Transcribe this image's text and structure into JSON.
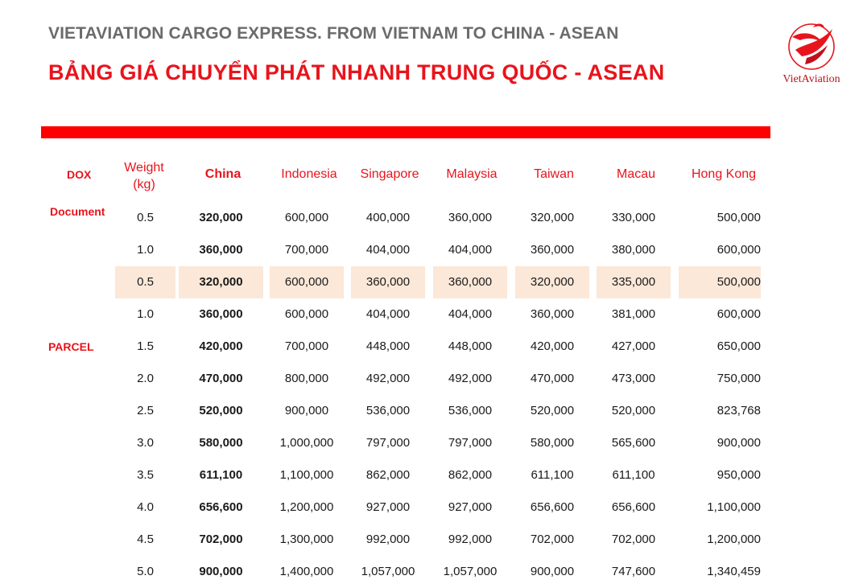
{
  "header": {
    "subtitle": "VIETAVIATION CARGO EXPRESS. FROM VIETNAM TO CHINA - ASEAN",
    "title": "BẢNG GIÁ CHUYỂN PHÁT NHANH TRUNG QUỐC - ASEAN"
  },
  "logo": {
    "text": "VietAviation"
  },
  "colors": {
    "brand_red": "#e8141c",
    "bar_red": "#ff0000",
    "highlight": "#fce8d8",
    "subtitle_gray": "#6b6b6b"
  },
  "table": {
    "headers": {
      "dox": "DOX",
      "weight": "Weight (kg)",
      "china": "China",
      "indonesia": "Indonesia",
      "singapore": "Singapore",
      "malaysia": "Malaysia",
      "taiwan": "Taiwan",
      "macau": "Macau",
      "hongkong": "Hong Kong"
    },
    "section_labels": {
      "document": "Document",
      "parcel": "PARCEL"
    },
    "rows": [
      {
        "weight": "0.5",
        "china": "320,000",
        "indonesia": "600,000",
        "singapore": "400,000",
        "malaysia": "360,000",
        "taiwan": "320,000",
        "macau": "330,000",
        "hongkong": "500,000"
      },
      {
        "weight": "1.0",
        "china": "360,000",
        "indonesia": "700,000",
        "singapore": "404,000",
        "malaysia": "404,000",
        "taiwan": "360,000",
        "macau": "380,000",
        "hongkong": "600,000"
      },
      {
        "weight": "0.5",
        "china": "320,000",
        "indonesia": "600,000",
        "singapore": "360,000",
        "malaysia": "360,000",
        "taiwan": "320,000",
        "macau": "335,000",
        "hongkong": "500,000"
      },
      {
        "weight": "1.0",
        "china": "360,000",
        "indonesia": "600,000",
        "singapore": "404,000",
        "malaysia": "404,000",
        "taiwan": "360,000",
        "macau": "381,000",
        "hongkong": "600,000"
      },
      {
        "weight": "1.5",
        "china": "420,000",
        "indonesia": "700,000",
        "singapore": "448,000",
        "malaysia": "448,000",
        "taiwan": "420,000",
        "macau": "427,000",
        "hongkong": "650,000"
      },
      {
        "weight": "2.0",
        "china": "470,000",
        "indonesia": "800,000",
        "singapore": "492,000",
        "malaysia": "492,000",
        "taiwan": "470,000",
        "macau": "473,000",
        "hongkong": "750,000"
      },
      {
        "weight": "2.5",
        "china": "520,000",
        "indonesia": "900,000",
        "singapore": "536,000",
        "malaysia": "536,000",
        "taiwan": "520,000",
        "macau": "520,000",
        "hongkong": "823,768"
      },
      {
        "weight": "3.0",
        "china": "580,000",
        "indonesia": "1,000,000",
        "singapore": "797,000",
        "malaysia": "797,000",
        "taiwan": "580,000",
        "macau": "565,600",
        "hongkong": "900,000"
      },
      {
        "weight": "3.5",
        "china": "611,100",
        "indonesia": "1,100,000",
        "singapore": "862,000",
        "malaysia": "862,000",
        "taiwan": "611,100",
        "macau": "611,100",
        "hongkong": "950,000"
      },
      {
        "weight": "4.0",
        "china": "656,600",
        "indonesia": "1,200,000",
        "singapore": "927,000",
        "malaysia": "927,000",
        "taiwan": "656,600",
        "macau": "656,600",
        "hongkong": "1,100,000"
      },
      {
        "weight": "4.5",
        "china": "702,000",
        "indonesia": "1,300,000",
        "singapore": "992,000",
        "malaysia": "992,000",
        "taiwan": "702,000",
        "macau": "702,000",
        "hongkong": "1,200,000"
      },
      {
        "weight": "5.0",
        "china": "900,000",
        "indonesia": "1,400,000",
        "singapore": "1,057,000",
        "malaysia": "1,057,000",
        "taiwan": "900,000",
        "macau": "747,600",
        "hongkong": "1,340,459"
      }
    ]
  }
}
